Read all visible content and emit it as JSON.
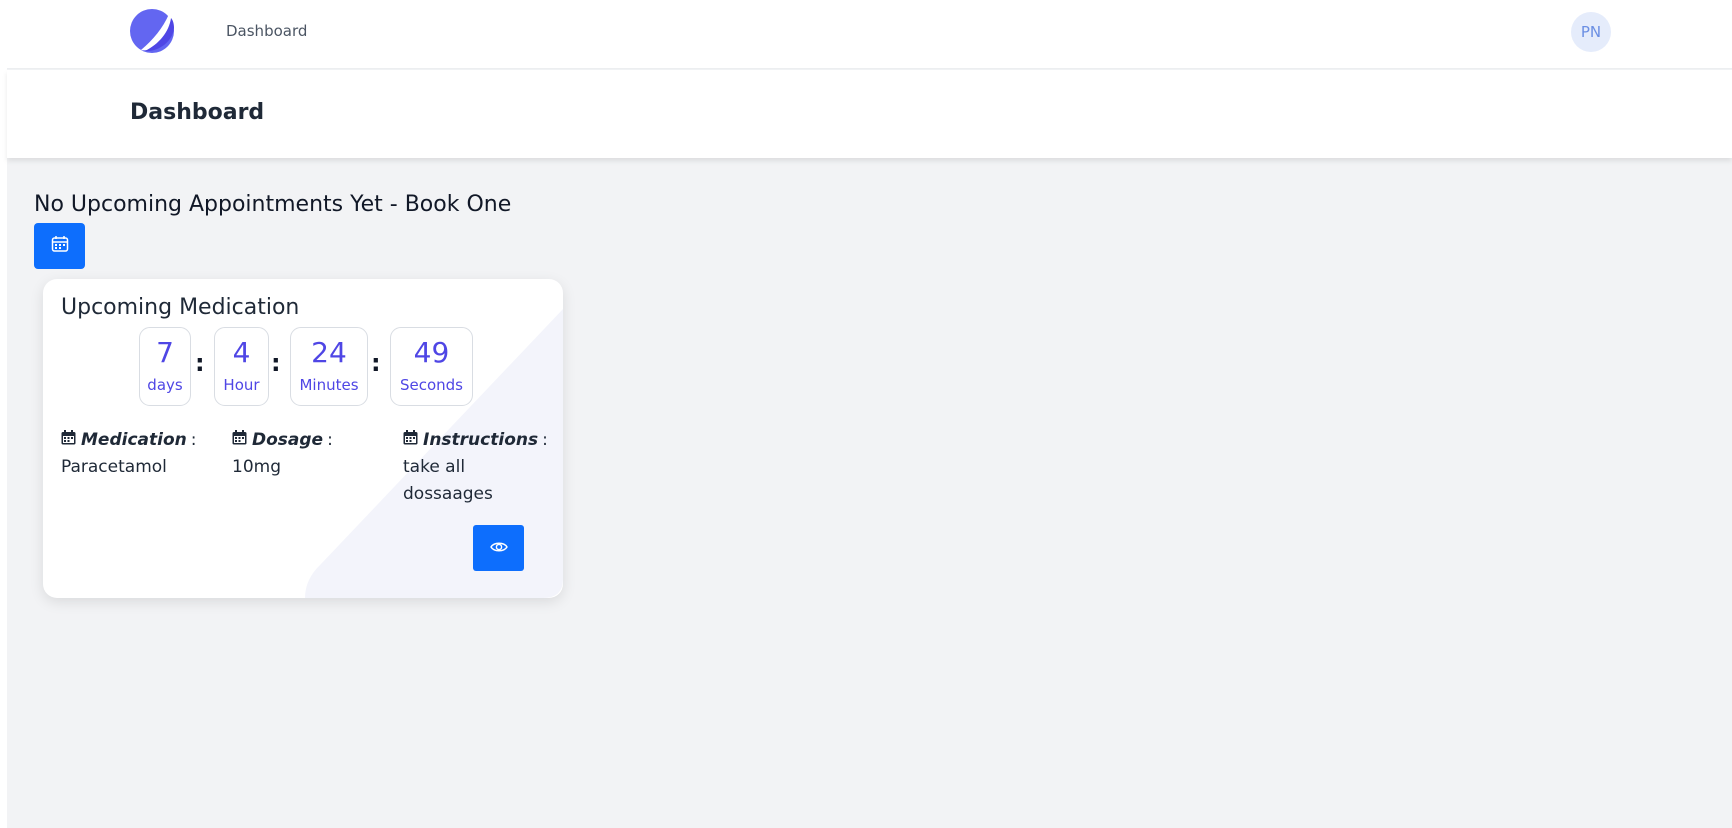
{
  "nav": {
    "logo": "app-logo",
    "link": "Dashboard",
    "avatar_initials": "PN"
  },
  "header": {
    "title": "Dashboard"
  },
  "appointments": {
    "message": "No Upcoming Appointments Yet - Book One",
    "book_icon": "calendar-icon"
  },
  "medication": {
    "title": "Upcoming Medication",
    "countdown": [
      {
        "value": "7",
        "label": "days"
      },
      {
        "value": "4",
        "label": "Hour"
      },
      {
        "value": "24",
        "label": "Minutes"
      },
      {
        "value": "49",
        "label": "Seconds"
      }
    ],
    "separator": ":",
    "fields": [
      {
        "key": "Medication",
        "colon": ":",
        "value": "Paracetamol"
      },
      {
        "key": "Dosage",
        "colon": ":",
        "value": "10mg"
      },
      {
        "key": "Instructions",
        "colon": ":",
        "value": "take all dossaages"
      }
    ],
    "view_icon": "eye-icon"
  },
  "colors": {
    "accent": "#0d6efd",
    "countdown_text": "#4f46e5",
    "logo": "#6366f1",
    "background": "#f2f3f5"
  }
}
